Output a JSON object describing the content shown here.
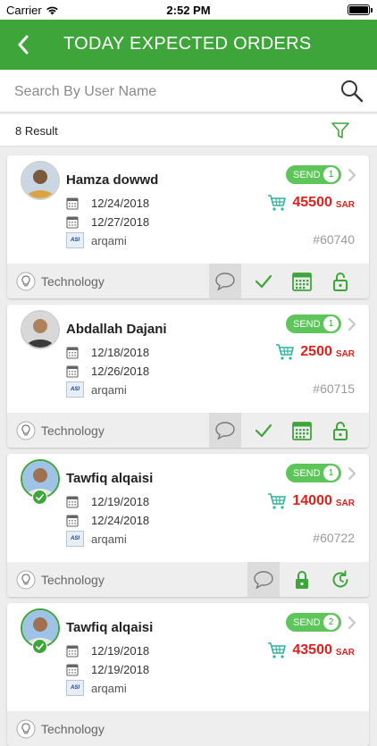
{
  "status": {
    "carrier": "Carrier",
    "time": "2:52 PM"
  },
  "nav": {
    "title": "TODAY EXPECTED ORDERS"
  },
  "search": {
    "placeholder": "Search By User Name"
  },
  "results": {
    "count": "8",
    "label": "Result"
  },
  "colors": {
    "primary": "#3ea53a",
    "amount": "#e0201b",
    "pill": "#5ec55a"
  },
  "orders": [
    {
      "name": "Hamza dowwd",
      "date1": "12/24/2018",
      "date2": "12/27/2018",
      "company": "arqami",
      "send_label": "SEND",
      "send_count": "1",
      "amount": "45500",
      "currency": "SAR",
      "order_id": "#60740",
      "category": "Technology",
      "online": false,
      "actions": [
        "chat-icon",
        "check-icon",
        "calendar-icon",
        "unlock-icon"
      ]
    },
    {
      "name": "Abdallah Dajani",
      "date1": "12/18/2018",
      "date2": "12/26/2018",
      "company": "arqami",
      "send_label": "SEND",
      "send_count": "1",
      "amount": "2500",
      "currency": "SAR",
      "order_id": "#60715",
      "category": "Technology",
      "online": false,
      "actions": [
        "chat-icon",
        "check-icon",
        "calendar-icon",
        "unlock-icon"
      ]
    },
    {
      "name": "Tawfiq alqaisi",
      "date1": "12/19/2018",
      "date2": "12/24/2018",
      "company": "arqami",
      "send_label": "SEND",
      "send_count": "1",
      "amount": "14000",
      "currency": "SAR",
      "order_id": "#60722",
      "category": "Technology",
      "online": true,
      "actions": [
        "chat-icon",
        "lock-icon",
        "restore-icon"
      ]
    },
    {
      "name": "Tawfiq alqaisi",
      "date1": "12/19/2018",
      "date2": "12/19/2018",
      "company": "arqami",
      "send_label": "SEND",
      "send_count": "2",
      "amount": "43500",
      "currency": "SAR",
      "order_id": "",
      "category": "Technology",
      "online": true,
      "actions": []
    }
  ]
}
